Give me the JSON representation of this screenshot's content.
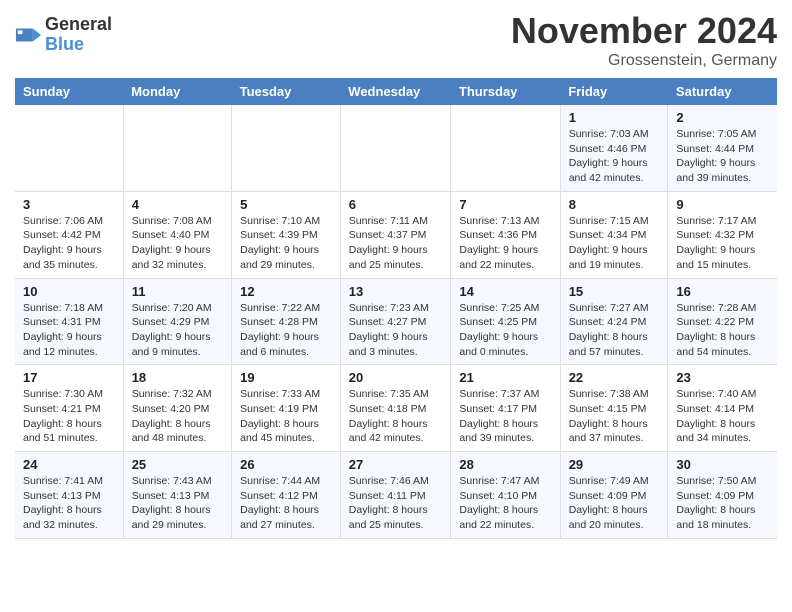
{
  "logo": {
    "general": "General",
    "blue": "Blue"
  },
  "header": {
    "month": "November 2024",
    "location": "Grossenstein, Germany"
  },
  "weekdays": [
    "Sunday",
    "Monday",
    "Tuesday",
    "Wednesday",
    "Thursday",
    "Friday",
    "Saturday"
  ],
  "weeks": [
    [
      {
        "day": "",
        "info": ""
      },
      {
        "day": "",
        "info": ""
      },
      {
        "day": "",
        "info": ""
      },
      {
        "day": "",
        "info": ""
      },
      {
        "day": "",
        "info": ""
      },
      {
        "day": "1",
        "info": "Sunrise: 7:03 AM\nSunset: 4:46 PM\nDaylight: 9 hours\nand 42 minutes."
      },
      {
        "day": "2",
        "info": "Sunrise: 7:05 AM\nSunset: 4:44 PM\nDaylight: 9 hours\nand 39 minutes."
      }
    ],
    [
      {
        "day": "3",
        "info": "Sunrise: 7:06 AM\nSunset: 4:42 PM\nDaylight: 9 hours\nand 35 minutes."
      },
      {
        "day": "4",
        "info": "Sunrise: 7:08 AM\nSunset: 4:40 PM\nDaylight: 9 hours\nand 32 minutes."
      },
      {
        "day": "5",
        "info": "Sunrise: 7:10 AM\nSunset: 4:39 PM\nDaylight: 9 hours\nand 29 minutes."
      },
      {
        "day": "6",
        "info": "Sunrise: 7:11 AM\nSunset: 4:37 PM\nDaylight: 9 hours\nand 25 minutes."
      },
      {
        "day": "7",
        "info": "Sunrise: 7:13 AM\nSunset: 4:36 PM\nDaylight: 9 hours\nand 22 minutes."
      },
      {
        "day": "8",
        "info": "Sunrise: 7:15 AM\nSunset: 4:34 PM\nDaylight: 9 hours\nand 19 minutes."
      },
      {
        "day": "9",
        "info": "Sunrise: 7:17 AM\nSunset: 4:32 PM\nDaylight: 9 hours\nand 15 minutes."
      }
    ],
    [
      {
        "day": "10",
        "info": "Sunrise: 7:18 AM\nSunset: 4:31 PM\nDaylight: 9 hours\nand 12 minutes."
      },
      {
        "day": "11",
        "info": "Sunrise: 7:20 AM\nSunset: 4:29 PM\nDaylight: 9 hours\nand 9 minutes."
      },
      {
        "day": "12",
        "info": "Sunrise: 7:22 AM\nSunset: 4:28 PM\nDaylight: 9 hours\nand 6 minutes."
      },
      {
        "day": "13",
        "info": "Sunrise: 7:23 AM\nSunset: 4:27 PM\nDaylight: 9 hours\nand 3 minutes."
      },
      {
        "day": "14",
        "info": "Sunrise: 7:25 AM\nSunset: 4:25 PM\nDaylight: 9 hours\nand 0 minutes."
      },
      {
        "day": "15",
        "info": "Sunrise: 7:27 AM\nSunset: 4:24 PM\nDaylight: 8 hours\nand 57 minutes."
      },
      {
        "day": "16",
        "info": "Sunrise: 7:28 AM\nSunset: 4:22 PM\nDaylight: 8 hours\nand 54 minutes."
      }
    ],
    [
      {
        "day": "17",
        "info": "Sunrise: 7:30 AM\nSunset: 4:21 PM\nDaylight: 8 hours\nand 51 minutes."
      },
      {
        "day": "18",
        "info": "Sunrise: 7:32 AM\nSunset: 4:20 PM\nDaylight: 8 hours\nand 48 minutes."
      },
      {
        "day": "19",
        "info": "Sunrise: 7:33 AM\nSunset: 4:19 PM\nDaylight: 8 hours\nand 45 minutes."
      },
      {
        "day": "20",
        "info": "Sunrise: 7:35 AM\nSunset: 4:18 PM\nDaylight: 8 hours\nand 42 minutes."
      },
      {
        "day": "21",
        "info": "Sunrise: 7:37 AM\nSunset: 4:17 PM\nDaylight: 8 hours\nand 39 minutes."
      },
      {
        "day": "22",
        "info": "Sunrise: 7:38 AM\nSunset: 4:15 PM\nDaylight: 8 hours\nand 37 minutes."
      },
      {
        "day": "23",
        "info": "Sunrise: 7:40 AM\nSunset: 4:14 PM\nDaylight: 8 hours\nand 34 minutes."
      }
    ],
    [
      {
        "day": "24",
        "info": "Sunrise: 7:41 AM\nSunset: 4:13 PM\nDaylight: 8 hours\nand 32 minutes."
      },
      {
        "day": "25",
        "info": "Sunrise: 7:43 AM\nSunset: 4:13 PM\nDaylight: 8 hours\nand 29 minutes."
      },
      {
        "day": "26",
        "info": "Sunrise: 7:44 AM\nSunset: 4:12 PM\nDaylight: 8 hours\nand 27 minutes."
      },
      {
        "day": "27",
        "info": "Sunrise: 7:46 AM\nSunset: 4:11 PM\nDaylight: 8 hours\nand 25 minutes."
      },
      {
        "day": "28",
        "info": "Sunrise: 7:47 AM\nSunset: 4:10 PM\nDaylight: 8 hours\nand 22 minutes."
      },
      {
        "day": "29",
        "info": "Sunrise: 7:49 AM\nSunset: 4:09 PM\nDaylight: 8 hours\nand 20 minutes."
      },
      {
        "day": "30",
        "info": "Sunrise: 7:50 AM\nSunset: 4:09 PM\nDaylight: 8 hours\nand 18 minutes."
      }
    ]
  ]
}
